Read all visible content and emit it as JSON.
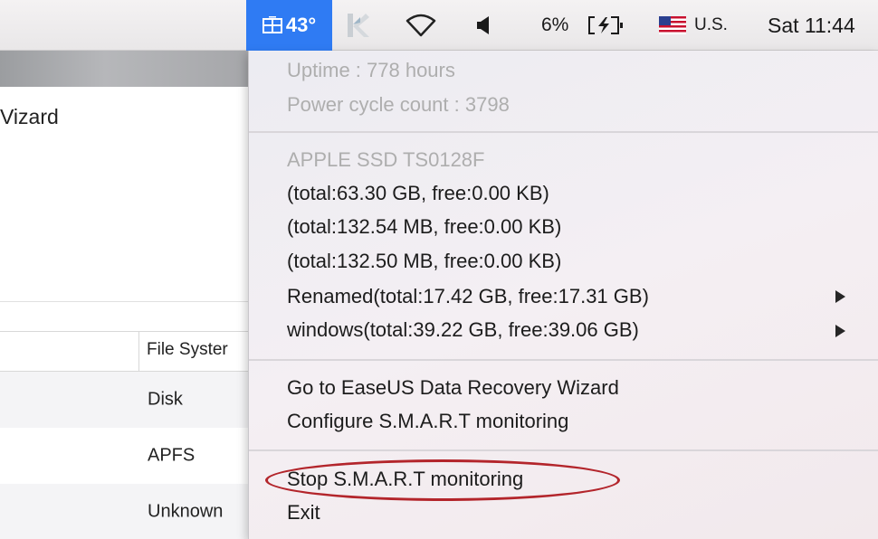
{
  "menubar": {
    "temperature": "43°",
    "battery_percent": "6%",
    "input_source": "U.S.",
    "clock": "Sat 11:44",
    "icons": [
      "disk-temperature-icon",
      "k-app-icon",
      "wifi-icon",
      "volume-icon",
      "battery-charging-icon",
      "us-flag-icon"
    ]
  },
  "window": {
    "title": "Vizard",
    "table": {
      "column_header": "File Syster",
      "rows": [
        "Disk",
        "APFS",
        "Unknown"
      ]
    }
  },
  "menu": {
    "uptime": "Uptime : 778 hours",
    "power_cycle": "Power cycle count : 3798",
    "disk_name": "APPLE SSD TS0128F",
    "partitions": [
      "(total:63.30 GB, free:0.00 KB)",
      "(total:132.54 MB, free:0.00 KB)",
      "(total:132.50 MB, free:0.00 KB)",
      "Renamed(total:17.42 GB, free:17.31 GB)",
      "windows(total:39.22 GB, free:39.06 GB)"
    ],
    "actions": [
      "Go to EaseUS Data Recovery Wizard",
      "Configure S.M.A.R.T monitoring"
    ],
    "stop_monitoring": "Stop S.M.A.R.T monitoring",
    "exit": "Exit"
  },
  "colors": {
    "accent": "#2f7bf3",
    "highlight_oval": "#b3252b",
    "disabled_text": "#aeaeae"
  }
}
